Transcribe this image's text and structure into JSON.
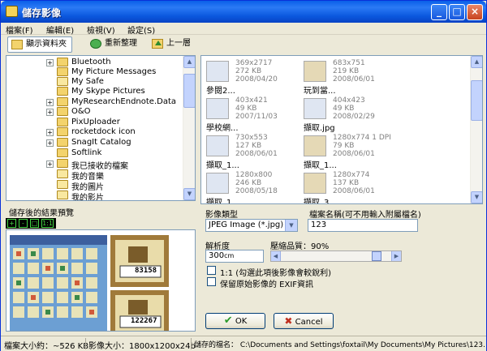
{
  "window": {
    "title": "儲存影像"
  },
  "menu": [
    {
      "label": "檔案(F)"
    },
    {
      "label": "編輯(E)"
    },
    {
      "label": "檢視(V)"
    },
    {
      "label": "設定(S)"
    }
  ],
  "toolbar": {
    "show_folder": "顯示資料夾",
    "refresh": "重新整理",
    "up": "上一層"
  },
  "tree": {
    "items": [
      {
        "label": "Bluetooth"
      },
      {
        "label": "My Picture Messages"
      },
      {
        "label": "My Safe"
      },
      {
        "label": "My Skype Pictures"
      },
      {
        "label": "MyResearchEndnote.Data"
      },
      {
        "label": "O&O"
      },
      {
        "label": "PixUploader"
      },
      {
        "label": "rocketdock icon"
      },
      {
        "label": "SnagIt Catalog"
      },
      {
        "label": "Softlink"
      },
      {
        "label": "我已接收的檔案"
      },
      {
        "label": "我的音樂"
      },
      {
        "label": "我的圖片"
      },
      {
        "label": "我的影片"
      }
    ]
  },
  "preview": {
    "label": "儲存後的結果預覽",
    "btn_zoom_in": "+",
    "btn_zoom_out": "-",
    "btn_fit": "□",
    "btn_actual": "1:1",
    "score_top": "83158",
    "score_bottom": "122267"
  },
  "thumbnails": [
    {
      "dims": "369x2717",
      "size": "272 KB",
      "date": "2008/04/20",
      "name": "參閱2..."
    },
    {
      "dims": "683x751",
      "size": "219 KB",
      "date": "2008/06/01",
      "name": "玩到當..."
    },
    {
      "dims": "403x421",
      "size": "49 KB",
      "date": "2007/11/03",
      "name": "學校網..."
    },
    {
      "dims": "404x423",
      "size": "49 KB",
      "date": "2008/02/29",
      "name": "擷取.jpg"
    },
    {
      "dims": "730x553",
      "size": "127 KB",
      "date": "2008/06/01",
      "name": "擷取_1..."
    },
    {
      "dims": "1280x774 1 DPI",
      "size": "79 KB",
      "date": "2008/06/01",
      "name": "擷取_1..."
    },
    {
      "dims": "1280x800",
      "size": "246 KB",
      "date": "2008/05/18",
      "name": "擷取_1..."
    },
    {
      "dims": "1280x774",
      "size": "137 KB",
      "date": "2008/06/01",
      "name": "擷取_3..."
    }
  ],
  "form": {
    "type_label": "影像類型",
    "type_value": "JPEG Image (*.jpg)",
    "filename_label": "檔案名稱(可不用輸入附屬檔名)",
    "filename_value": "123",
    "resolution_label": "解析度",
    "resolution_value": "300",
    "resolution_unit": "cm",
    "quality_label": "壓縮品質：90%",
    "quality_fraction": 0.9,
    "check1_label": "1:1 (勾選此項後影像會較銳利)",
    "check2_label": "保留原始影像的 EXIF資訊",
    "ok": "OK",
    "cancel": "Cancel"
  },
  "status": {
    "file_size": "檔案大小約：~526 KB",
    "image_size": "影像大小：1800x1200x24b",
    "save_path": "儲存的檔名： C:\\Documents and Settings\\foxtail\\My Documents\\My Pictures\\123.jpg"
  }
}
